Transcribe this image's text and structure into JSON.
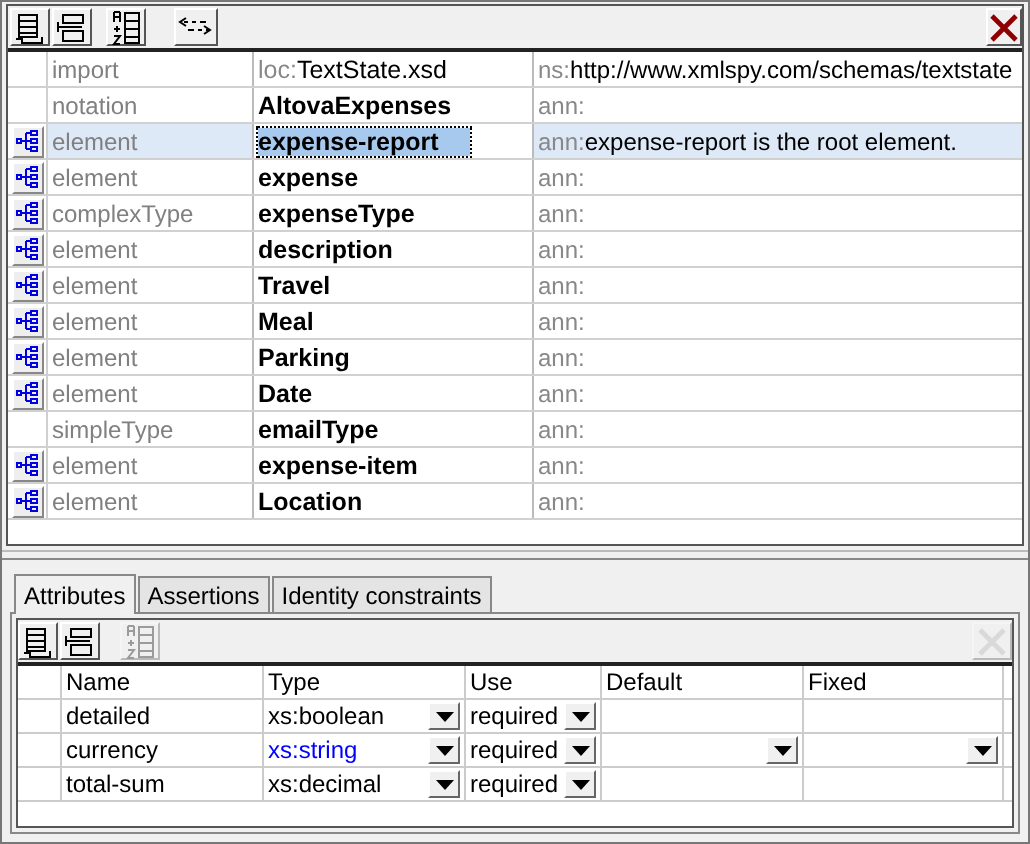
{
  "components": {
    "rows": [
      {
        "expandable": false,
        "kind": "import",
        "name_prefix": "loc:",
        "name": "TextState.xsd",
        "name_bold": false,
        "detail_prefix": "ns:",
        "detail": "http://www.xmlspy.com/schemas/textstate",
        "selected": false
      },
      {
        "expandable": false,
        "kind": "notation",
        "name": "AltovaExpenses",
        "name_bold": true,
        "detail_prefix": "ann:",
        "selected": false
      },
      {
        "expandable": true,
        "kind": "element",
        "name": "expense-report",
        "name_bold": true,
        "detail_prefix": "ann:",
        "detail": "expense-report is the root element.",
        "selected": true
      },
      {
        "expandable": true,
        "kind": "element",
        "name": "expense",
        "name_bold": true,
        "detail_prefix": "ann:",
        "selected": false
      },
      {
        "expandable": true,
        "kind": "complexType",
        "name": "expenseType",
        "name_bold": true,
        "detail_prefix": "ann:",
        "selected": false
      },
      {
        "expandable": true,
        "kind": "element",
        "name": "description",
        "name_bold": true,
        "detail_prefix": "ann:",
        "selected": false
      },
      {
        "expandable": true,
        "kind": "element",
        "name": "Travel",
        "name_bold": true,
        "detail_prefix": "ann:",
        "selected": false
      },
      {
        "expandable": true,
        "kind": "element",
        "name": "Meal",
        "name_bold": true,
        "detail_prefix": "ann:",
        "selected": false
      },
      {
        "expandable": true,
        "kind": "element",
        "name": "Parking",
        "name_bold": true,
        "detail_prefix": "ann:",
        "selected": false
      },
      {
        "expandable": true,
        "kind": "element",
        "name": "Date",
        "name_bold": true,
        "detail_prefix": "ann:",
        "selected": false
      },
      {
        "expandable": false,
        "kind": "simpleType",
        "name": "emailType",
        "name_bold": true,
        "detail_prefix": "ann:",
        "selected": false
      },
      {
        "expandable": true,
        "kind": "element",
        "name": "expense-item",
        "name_bold": true,
        "detail_prefix": "ann:",
        "selected": false
      },
      {
        "expandable": true,
        "kind": "element",
        "name": "Location",
        "name_bold": true,
        "detail_prefix": "ann:",
        "selected": false
      }
    ]
  },
  "tabs": [
    {
      "label": "Attributes",
      "selected": true
    },
    {
      "label": "Assertions",
      "selected": false
    },
    {
      "label": "Identity constraints",
      "selected": false
    }
  ],
  "attributes": {
    "columns": [
      "Name",
      "Type",
      "Use",
      "Default",
      "Fixed"
    ],
    "rows": [
      {
        "name": "detailed",
        "type": "xs:boolean",
        "color": "#000000",
        "use": "required",
        "default_dropdown": false,
        "fixed_dropdown": false
      },
      {
        "name": "currency",
        "type": "xs:string",
        "color": "#0000ff",
        "use": "required",
        "default_dropdown": true,
        "fixed_dropdown": true
      },
      {
        "name": "total-sum",
        "type": "xs:decimal",
        "color": "#000000",
        "use": "required",
        "default_dropdown": false,
        "fixed_dropdown": false
      }
    ]
  }
}
